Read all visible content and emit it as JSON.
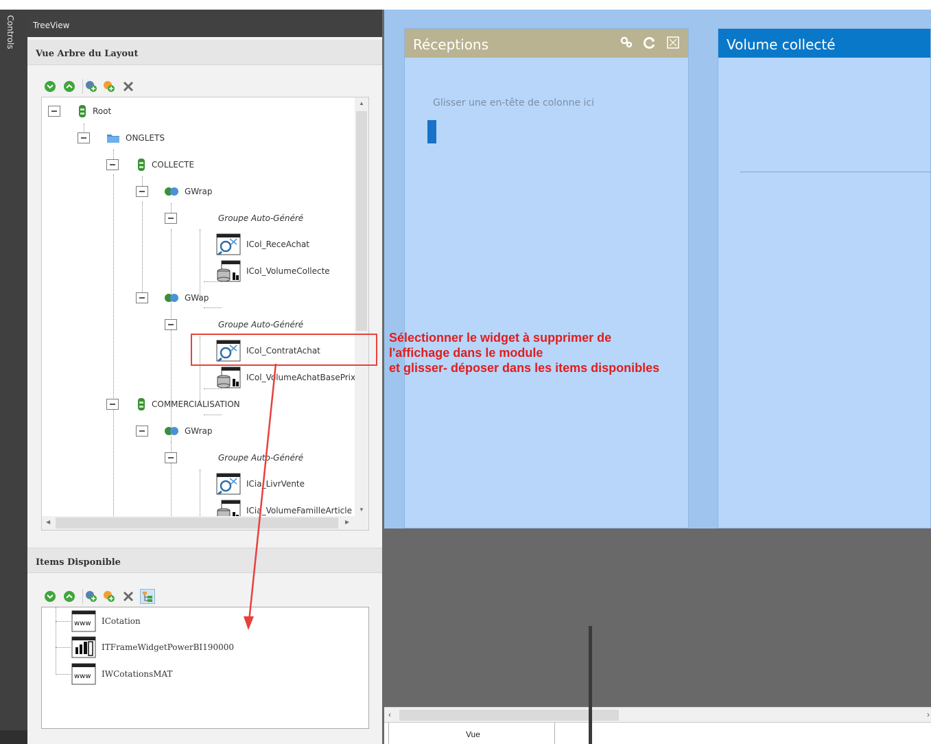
{
  "side_strip": {
    "label": "Controls"
  },
  "treeview": {
    "title": "TreeView",
    "layout_section_title": "Vue Arbre du Layout",
    "items_section_title": "Items Disponible"
  },
  "tree": {
    "root": "Root",
    "onglets": "ONGLETS",
    "collecte": "COLLECTE",
    "gwrap1": "GWrap",
    "group1": "Groupe Auto-Généré",
    "icol_receachat": "ICol_ReceAchat",
    "icol_volumecollecte": "ICol_VolumeCollecte",
    "gwap": "GWap",
    "group2": "Groupe Auto-Généré",
    "icol_contratachat": "ICol_ContratAchat",
    "icol_volumeachatbaseprix": "ICol_VolumeAchatBasePrix",
    "commercialisation": "COMMERCIALISATION",
    "gwrap2": "GWrap",
    "group3": "Groupe Auto-Généré",
    "icia_livrvente": "ICia_LivrVente",
    "icia_volumefamillearticle": "ICia_VolumeFamilleArticle"
  },
  "available_items": [
    {
      "label": "ICotation",
      "icon": "www"
    },
    {
      "label": "ITFrameWidgetPowerBI190000",
      "icon": "powerbi"
    },
    {
      "label": "IWCotationsMAT",
      "icon": "www"
    }
  ],
  "canvas": {
    "widget1_title": "Réceptions",
    "widget1_drop_hint": "Glisser une en-tête de colonne ici",
    "widget2_title": "Volume collecté",
    "tab_label": "Vue"
  },
  "annotation": {
    "line1": "Sélectionner le widget à supprimer de",
    "line2": "l'affichage dans le module",
    "line3": "et glisser- déposer dans les items disponibles"
  },
  "colors": {
    "annotation_red": "#e8413c",
    "widget1_header": "#b9b391",
    "widget2_header": "#0a78c8",
    "canvas_blue": "#b7d6fa"
  }
}
